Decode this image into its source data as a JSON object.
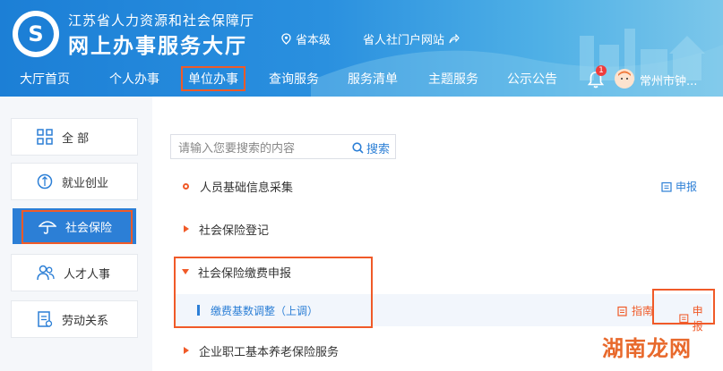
{
  "header": {
    "org_title": "江苏省人力资源和社会保障厅",
    "site_title": "网上办事服务大厅",
    "region": "省本级",
    "portal_link": "省人社门户网站",
    "notification_count": "1",
    "user_name": "常州市钟..."
  },
  "nav": {
    "items": [
      {
        "label": "大厅首页"
      },
      {
        "label": "个人办事"
      },
      {
        "label": "单位办事"
      },
      {
        "label": "查询服务"
      },
      {
        "label": "服务清单"
      },
      {
        "label": "主题服务"
      },
      {
        "label": "公示公告"
      }
    ],
    "active": "单位办事"
  },
  "sidebar": {
    "items": [
      {
        "label": "全 部",
        "icon": "grid-icon"
      },
      {
        "label": "就业创业",
        "icon": "medal-icon"
      },
      {
        "label": "社会保险",
        "icon": "umbrella-icon"
      },
      {
        "label": "人才人事",
        "icon": "people-icon"
      },
      {
        "label": "劳动关系",
        "icon": "document-icon"
      }
    ],
    "active": "社会保险"
  },
  "search": {
    "placeholder": "请输入您要搜索的内容",
    "button_label": "搜索"
  },
  "services": [
    {
      "label": "人员基础信息采集",
      "action": "申报"
    },
    {
      "label": "社会保险登记"
    },
    {
      "label": "社会保险缴费申报"
    },
    {
      "label": "企业职工基本养老保险服务"
    }
  ],
  "sub_service": {
    "label": "缴费基数调整（上调）",
    "guide_label": "指南",
    "declare_label": "申报"
  },
  "watermark": "湖南龙网",
  "colors": {
    "primary": "#2c7fd6",
    "accent": "#f05a28"
  }
}
